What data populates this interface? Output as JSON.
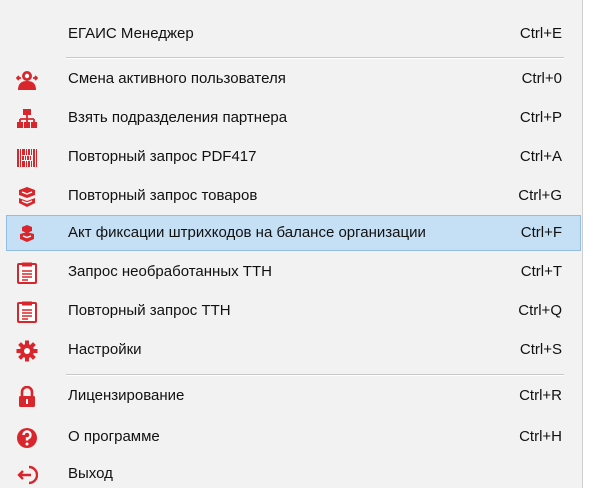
{
  "menu": {
    "items": [
      {
        "label": "ЕГАИС Менеджер",
        "shortcut": "Ctrl+E",
        "icon": "none"
      },
      {
        "label": "Смена активного пользователя",
        "shortcut": "Ctrl+0",
        "icon": "user-switch-icon"
      },
      {
        "label": "Взять подразделения партнера",
        "shortcut": "Ctrl+P",
        "icon": "org-structure-icon"
      },
      {
        "label": "Повторный запрос PDF417",
        "shortcut": "Ctrl+A",
        "icon": "barcode-icon"
      },
      {
        "label": "Повторный запрос товаров",
        "shortcut": "Ctrl+G",
        "icon": "goods-request-icon"
      },
      {
        "label": "Акт фиксации штрихкодов на балансе организации",
        "shortcut": "Ctrl+F",
        "icon": "barcode-balance-icon",
        "selected": true
      },
      {
        "label": "Запрос необработанных ТТН",
        "shortcut": "Ctrl+T",
        "icon": "document-icon"
      },
      {
        "label": "Повторный запрос ТТН",
        "shortcut": "Ctrl+Q",
        "icon": "document-icon"
      },
      {
        "label": "Настройки",
        "shortcut": "Ctrl+S",
        "icon": "gear-icon"
      },
      {
        "label": "Лицензирование",
        "shortcut": "Ctrl+R",
        "icon": "lock-icon"
      },
      {
        "label": "О программе",
        "shortcut": "Ctrl+H",
        "icon": "help-icon"
      },
      {
        "label": "Выход",
        "shortcut": "",
        "icon": "exit-icon"
      }
    ]
  },
  "colors": {
    "icon_red": "#d9262c",
    "highlight": "#c5dff5",
    "highlight_border": "#93bde3"
  }
}
